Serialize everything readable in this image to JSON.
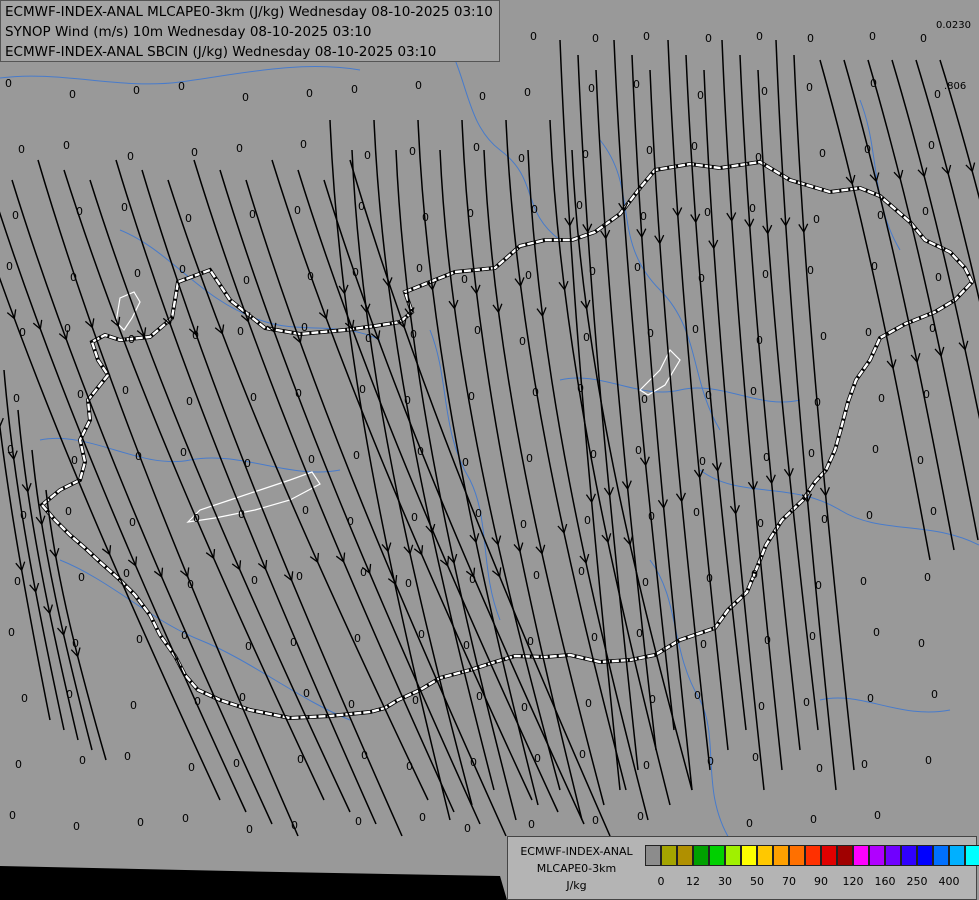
{
  "titles": [
    "ECMWF-INDEX-ANAL MLCAPE0-3km (J/kg) Wednesday 08-10-2025 03:10",
    "SYNOP Wind (m/s) 10m Wednesday 08-10-2025 03:10",
    "ECMWF-INDEX-ANAL SBCIN (J/kg) Wednesday 08-10-2025 03:10"
  ],
  "corner_values": {
    "top": "0.0230",
    "second": ".806"
  },
  "station_value": "0",
  "legend": {
    "name_lines": [
      "ECMWF-INDEX-ANAL",
      "MLCAPE0-3km",
      "J/kg"
    ],
    "colors": [
      "#8c8c8c",
      "#a4a400",
      "#b09000",
      "#00a000",
      "#00d000",
      "#a0f000",
      "#ffff00",
      "#ffc800",
      "#ffa000",
      "#ff7000",
      "#ff3000",
      "#e00000",
      "#a00000",
      "#ff00ff",
      "#b000ff",
      "#7000ff",
      "#3000ff",
      "#0000ff",
      "#0070ff",
      "#00b0ff",
      "#00ffff",
      "#a0ffff",
      "#ffffff"
    ],
    "ticks": [
      {
        "label": "0",
        "at": 1
      },
      {
        "label": "12",
        "at": 3
      },
      {
        "label": "30",
        "at": 5
      },
      {
        "label": "50",
        "at": 7
      },
      {
        "label": "70",
        "at": 9
      },
      {
        "label": "90",
        "at": 11
      },
      {
        "label": "120",
        "at": 13
      },
      {
        "label": "160",
        "at": 15
      },
      {
        "label": "250",
        "at": 17
      },
      {
        "label": "400",
        "at": 19
      }
    ]
  }
}
